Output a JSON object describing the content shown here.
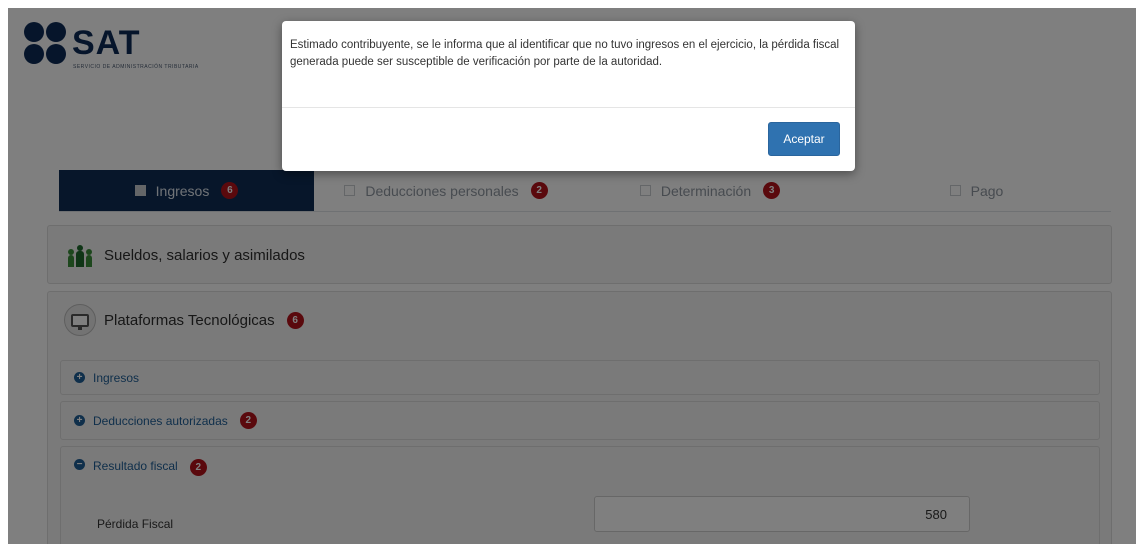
{
  "header": {
    "logo_text": "SAT",
    "logo_subtitle": "SERVICIO DE ADMINISTRACIÓN TRIBUTARIA"
  },
  "tabs": [
    {
      "label": "Ingresos",
      "badge": "6",
      "active": true
    },
    {
      "label": "Deducciones personales",
      "badge": "2",
      "active": false
    },
    {
      "label": "Determinación",
      "badge": "3",
      "active": false
    },
    {
      "label": "Pago",
      "badge": "",
      "active": false
    }
  ],
  "sections": {
    "sueldos": {
      "title": "Sueldos, salarios y asimilados"
    },
    "plataformas": {
      "title": "Plataformas Tecnológicas",
      "badge": "6",
      "subsections": [
        {
          "label": "Ingresos",
          "badge": "",
          "icon": "plus-circle-icon"
        },
        {
          "label": "Deducciones autorizadas",
          "badge": "2",
          "icon": "plus-circle-icon"
        },
        {
          "label": "Resultado fiscal",
          "badge": "2",
          "icon": "minus-circle-icon"
        }
      ]
    }
  },
  "form": {
    "perdida_fiscal_label": "Pérdida Fiscal",
    "perdida_fiscal_value": "580"
  },
  "modal": {
    "message": "Estimado contribuyente, se le informa que al identificar que no tuvo ingresos en el ejercicio, la pérdida fiscal generada puede ser susceptible de verificación por parte de la autoridad.",
    "accept_label": "Aceptar"
  },
  "colors": {
    "brand_navy": "#0f2d55",
    "badge_red": "#b5121b",
    "link_blue": "#1f5e96",
    "button_blue": "#2f72b0"
  }
}
